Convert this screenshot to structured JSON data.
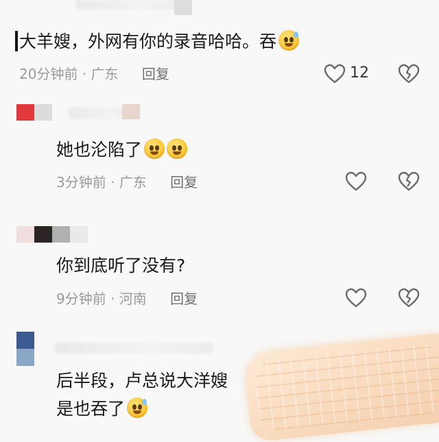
{
  "comments": [
    {
      "text": "大羊嫂，外网有你的录音哈哈。吞",
      "time": "20分钟前",
      "location": "广东",
      "reply_label": "回复",
      "likes": "12"
    },
    {
      "text": "她也沦陷了",
      "time": "3分钟前",
      "location": "广东",
      "reply_label": "回复",
      "likes": ""
    },
    {
      "text": "你到底听了没有?",
      "time": "9分钟前",
      "location": "河南",
      "reply_label": "回复",
      "likes": ""
    },
    {
      "text_line1": "后半段，卢总说大洋嫂",
      "text_line2": "是也吞了"
    }
  ],
  "icons": {
    "like": "heart-outline-icon",
    "dislike": "broken-heart-icon",
    "emoji": "grinning-sweat-emoji",
    "emoji_pleading": "pleading-face-emoji"
  },
  "separator": "·",
  "colors": {
    "meta_text": "#9a9a9a",
    "reply_text": "#6f6f6f",
    "icon_stroke": "#6a6a6a",
    "background": "#f8f8f8"
  }
}
